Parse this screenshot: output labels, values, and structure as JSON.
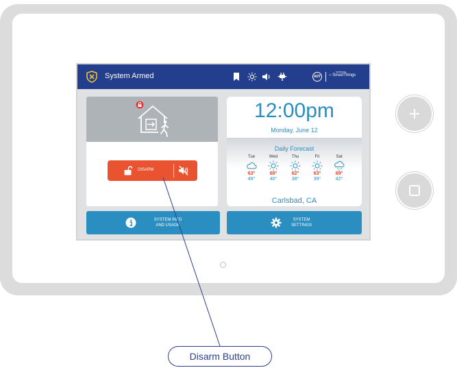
{
  "device": {
    "side_buttons": [
      {
        "name": "plus",
        "icon": "plus-icon"
      },
      {
        "name": "square",
        "icon": "square-icon"
      }
    ]
  },
  "status_bar": {
    "title": "System Armed",
    "icons": [
      "bookmark-icon",
      "brightness-icon",
      "volume-icon",
      "power-plug-icon"
    ],
    "brand_adt": "ADT",
    "brand_samsung": "SAMSUNG",
    "brand_smartthings": "SmartThings",
    "color": "#233e8c"
  },
  "security_panel": {
    "disarm_label": "DISARM",
    "disarm_color": "#e9532f"
  },
  "clock_panel": {
    "time": "12:00pm",
    "date": "Monday, June 12"
  },
  "forecast": {
    "title": "Daily Forecast",
    "city": "Carlsbad, CA",
    "days": [
      {
        "day": "Tue",
        "icon": "cloud-icon",
        "high": "63°",
        "low": "49°"
      },
      {
        "day": "Wed",
        "icon": "sun-icon",
        "high": "60°",
        "low": "40°"
      },
      {
        "day": "Thu",
        "icon": "sun-icon",
        "high": "62°",
        "low": "38°"
      },
      {
        "day": "Fri",
        "icon": "sun-icon",
        "high": "63°",
        "low": "39°"
      },
      {
        "day": "Sat",
        "icon": "rain-cloud-icon",
        "high": "69°",
        "low": "42°"
      }
    ]
  },
  "bottom_buttons": {
    "info_line1": "SYSTEM INFO",
    "info_line2": "AND USAGE",
    "settings_line1": "SYSTEM",
    "settings_line2": "SETTINGS",
    "color": "#2a8ec0"
  },
  "annotation": {
    "label": "Disarm Button"
  }
}
